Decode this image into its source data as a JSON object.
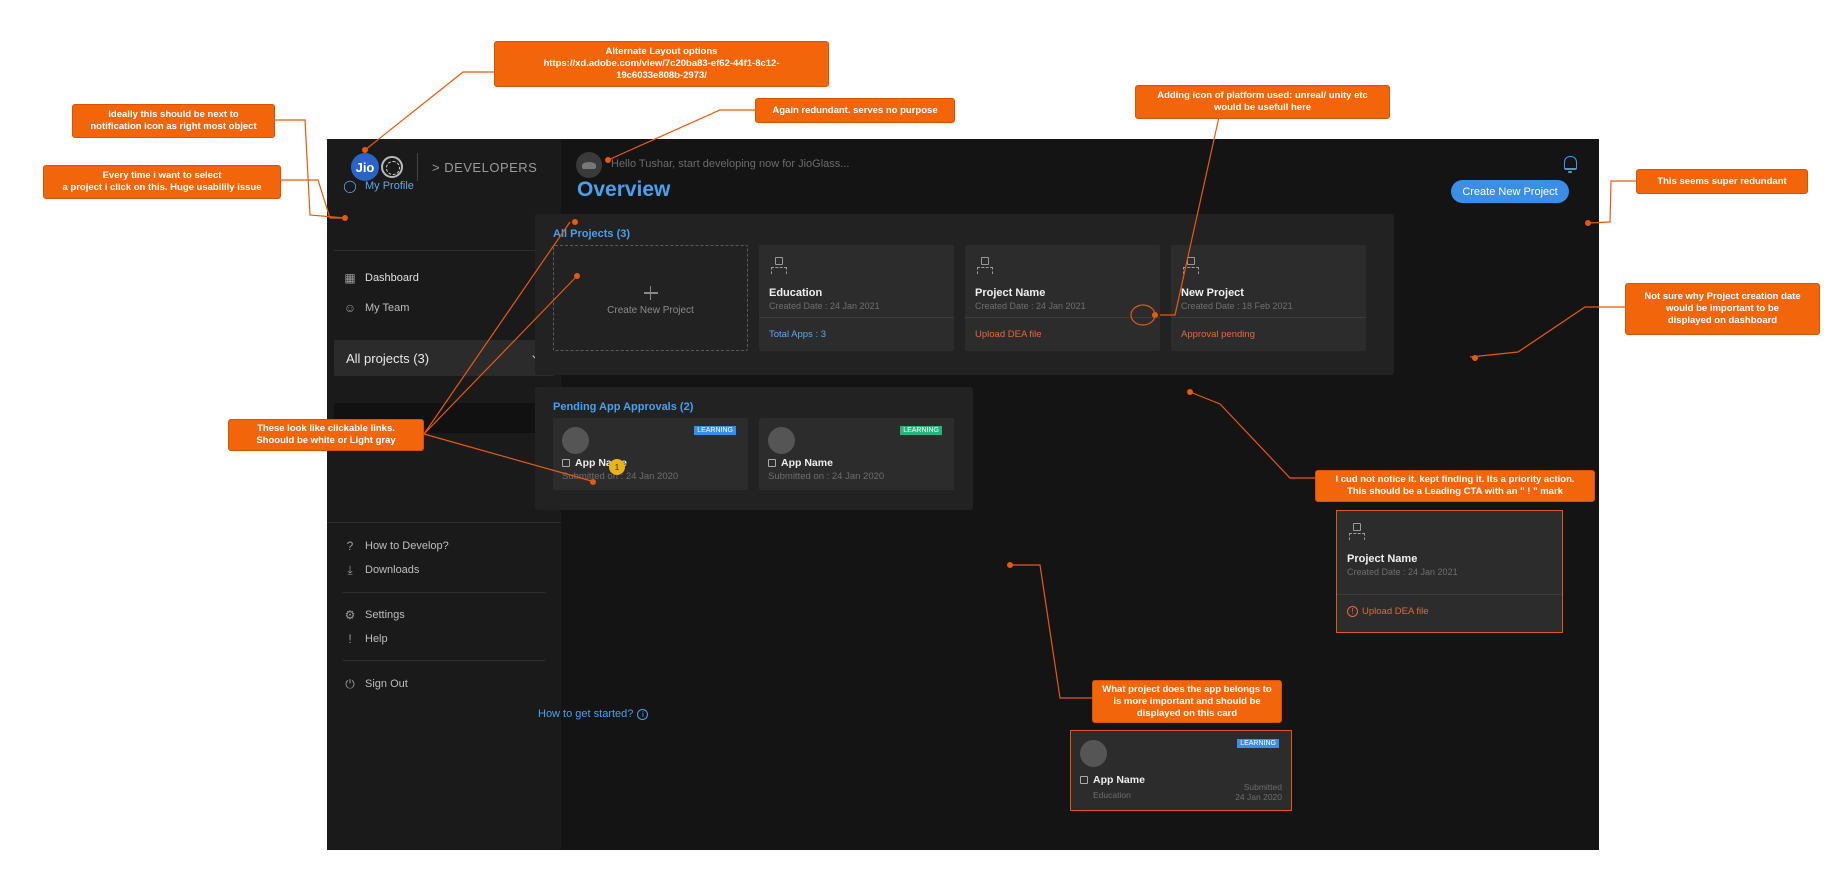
{
  "app": {
    "logo_text": "Jio",
    "section_label": "> DEVELOPERS",
    "greeting": "Hello Tushar, start developing now for JioGlass..."
  },
  "sidebar": {
    "my_profile": "My Profile",
    "project_select": "All projects (3)",
    "items": [
      {
        "label": "Dashboard"
      },
      {
        "label": "My Team"
      },
      {
        "label": "How to Develop?"
      },
      {
        "label": "Downloads"
      },
      {
        "label": "Settings"
      },
      {
        "label": "Help"
      },
      {
        "label": "Sign Out"
      }
    ]
  },
  "main": {
    "title": "Overview",
    "create_button": "Create New Project",
    "all_projects": {
      "title": "All Projects (3)",
      "create_card_label": "Create New Project",
      "cards": [
        {
          "name": "Education",
          "date": "Created Date : 24 Jan 2021",
          "footer": "Total Apps : 3"
        },
        {
          "name": "Project Name",
          "date": "Created Date : 24 Jan 2021",
          "footer": "Upload DEA file"
        },
        {
          "name": "New Project",
          "date": "Created Date : 18 Feb 2021",
          "footer": "Approval pending"
        }
      ]
    },
    "pending": {
      "title": "Pending App Approvals (2)",
      "cards": [
        {
          "name": "App Name",
          "sub": "Submitted on : 24 Jan 2020",
          "tag": "LEARNING",
          "badge": "1"
        },
        {
          "name": "App Name",
          "sub": "Submitted on : 24 Jan 2020",
          "tag": "LEARNING"
        }
      ]
    },
    "how_to_start": "How to get started?"
  },
  "suggestions": {
    "project_card": {
      "name": "Project Name",
      "date": "Created Date : 24 Jan 2021",
      "footer": "Upload DEA file"
    },
    "app_card": {
      "name": "App Name",
      "project": "Education",
      "tag": "LEARNING",
      "submitted": "Submitted",
      "date": "24 Jan 2020"
    }
  },
  "callouts": {
    "alternate_layout": "Alternate Layout options\nhttps://xd.adobe.com/view/7c20ba83-ef62-44f1-8c12-\n19c6033e808b-2973/",
    "profile_position": "Ideally this should be next to\nnotification icon as right most object",
    "project_select": "Every time i want to select\na project i click on this. Huge usabilily issue",
    "redundant_greeting": "Again redundant. serves no purpose",
    "platform_icon": "Adding icon of platform used: unreal/ unity etc\nwould be usefull here",
    "super_redundant": "This seems super redundant",
    "creation_date": "Not sure why Project creation date\nwould be important to be\ndisplayed on dashboard",
    "clickable_links": "These look like clickable links.\nShoould be white or Light gray",
    "priority_action": "I cud not notice it. kept finding it. Its a priority action.\nThis should be a Leading CTA with an \" ! \" mark",
    "app_project": "What project does the app belongs to\nis more important and should be\ndisplayed on this card"
  }
}
